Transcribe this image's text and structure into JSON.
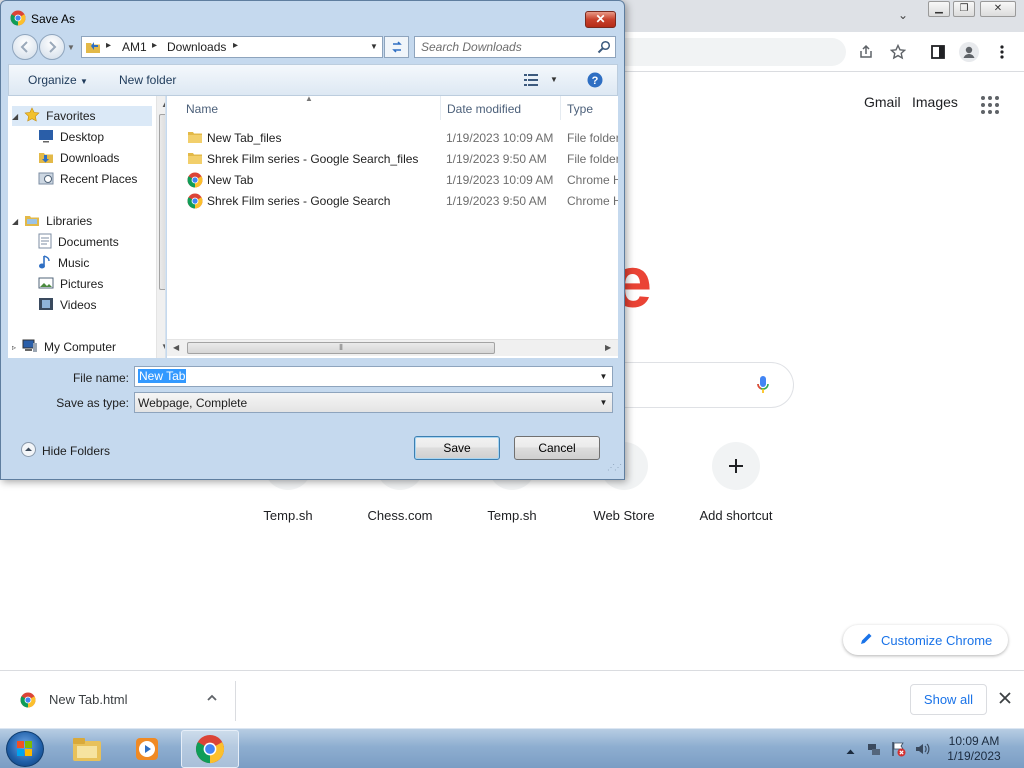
{
  "chrome": {
    "ntp_links": [
      "Gmail",
      "Images"
    ],
    "shortcuts": [
      {
        "label": "Temp.sh"
      },
      {
        "label": "Chess.com"
      },
      {
        "label": "Temp.sh"
      },
      {
        "label": "Web Store"
      },
      {
        "label": "Add shortcut"
      }
    ],
    "customize_label": "Customize Chrome",
    "logo_partial": "e"
  },
  "download_shelf": {
    "filename": "New Tab.html",
    "show_all_label": "Show all"
  },
  "taskbar": {
    "time": "10:09 AM",
    "date": "1/19/2023"
  },
  "dialog": {
    "title": "Save As",
    "close_label": "✕",
    "breadcrumb": [
      "AM1",
      "Downloads"
    ],
    "search_placeholder": "Search Downloads",
    "toolbar": {
      "organize_label": "Organize",
      "new_folder_label": "New folder"
    },
    "nav": {
      "favorites_label": "Favorites",
      "favorites": [
        "Desktop",
        "Downloads",
        "Recent Places"
      ],
      "libraries_label": "Libraries",
      "libraries": [
        "Documents",
        "Music",
        "Pictures",
        "Videos"
      ],
      "computer_label": "My Computer"
    },
    "columns": {
      "name": "Name",
      "date_modified": "Date modified",
      "type": "Type"
    },
    "files": [
      {
        "name": "New Tab_files",
        "date": "1/19/2023 10:09 AM",
        "type": "File folder",
        "icon": "folder-icon"
      },
      {
        "name": "Shrek Film series - Google Search_files",
        "date": "1/19/2023 9:50 AM",
        "type": "File folder",
        "icon": "folder-icon"
      },
      {
        "name": "New Tab",
        "date": "1/19/2023 10:09 AM",
        "type": "Chrome H",
        "icon": "chrome-icon"
      },
      {
        "name": "Shrek Film series - Google Search",
        "date": "1/19/2023 9:50 AM",
        "type": "Chrome H",
        "icon": "chrome-icon"
      }
    ],
    "form": {
      "file_name_label": "File name:",
      "file_name_value": "New Tab",
      "save_type_label": "Save as type:",
      "save_type_value": "Webpage, Complete"
    },
    "hide_folders_label": "Hide Folders",
    "save_label": "Save",
    "cancel_label": "Cancel"
  }
}
